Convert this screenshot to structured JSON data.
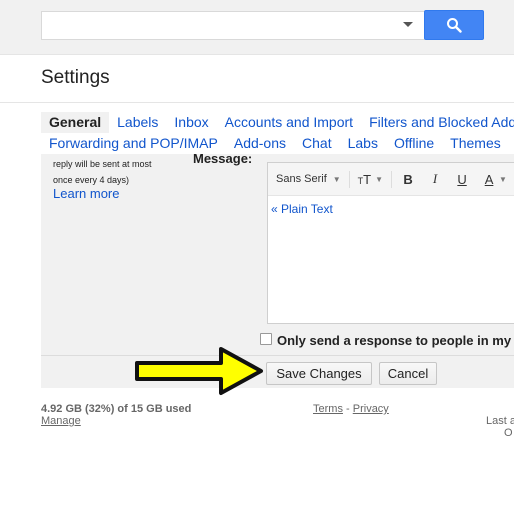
{
  "search": {
    "value": "",
    "placeholder": ""
  },
  "header": {
    "title": "Settings"
  },
  "tabs_row1": [
    {
      "label": "General",
      "active": true
    },
    {
      "label": "Labels"
    },
    {
      "label": "Inbox"
    },
    {
      "label": "Accounts and Import"
    },
    {
      "label": "Filters and Blocked Addr"
    }
  ],
  "tabs_row2": [
    {
      "label": "Forwarding and POP/IMAP"
    },
    {
      "label": "Add-ons"
    },
    {
      "label": "Chat"
    },
    {
      "label": "Labs"
    },
    {
      "label": "Offline"
    },
    {
      "label": "Themes"
    }
  ],
  "vacation": {
    "note_line1": "reply will be sent at most",
    "note_line2": "once every 4 days)",
    "learn_more": "Learn more",
    "message_label": "Message:"
  },
  "editor": {
    "font": "Sans Serif",
    "bold": "B",
    "italic": "I",
    "underline": "U",
    "text_color": "A",
    "plain_text_link": "« Plain Text"
  },
  "options": {
    "only_contacts_label": "Only send a response to people in my C"
  },
  "buttons": {
    "save": "Save Changes",
    "cancel": "Cancel"
  },
  "footer": {
    "storage": "4.92 GB (32%) of 15 GB used",
    "manage": "Manage",
    "terms": "Terms",
    "separator": "-",
    "privacy": "Privacy",
    "last_activity": "Last a",
    "last_activity2": "O"
  },
  "colors": {
    "accent": "#4285f4",
    "link": "#1155cc",
    "arrow": "#ffff00"
  }
}
